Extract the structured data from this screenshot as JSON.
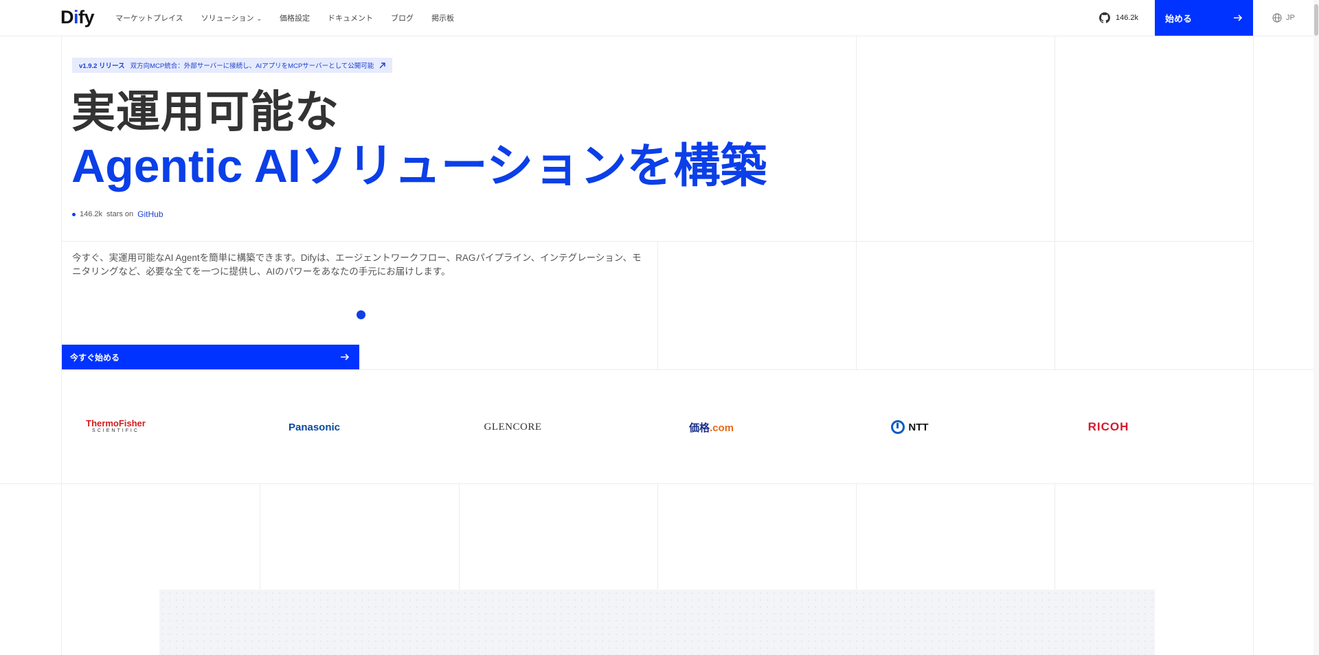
{
  "header": {
    "logo_text_d": "D",
    "logo_text_i": "i",
    "logo_text_fy": "fy",
    "nav": [
      "マーケットプレイス",
      "ソリューション",
      "価格設定",
      "ドキュメント",
      "ブログ",
      "掲示板"
    ],
    "github_stars": "146.2k",
    "start_label": "始める",
    "lang": "JP"
  },
  "hero": {
    "release_version": "v1.9.2 リリース",
    "release_text": "双方向MCP統合：外部サーバーに接続し、AIアプリをMCPサーバーとして公開可能",
    "title_line1": "実運用可能な",
    "title_line2": "Agentic AIソリューションを構築",
    "stars_count": "146.2k",
    "stars_mid": "stars on",
    "stars_link": "GitHub",
    "description": "今すぐ、実運用可能なAI Agentを簡単に構築できます。Difyは、エージェントワークフロー、RAGパイプライン、インテグレーション、モニタリングなど、必要な全てを一つに提供し、AIのパワーをあなたの手元にお届けします。",
    "cta_label": "今すぐ始める"
  },
  "logos": {
    "thermo_top": "ThermoFisher",
    "thermo_bottom": "SCIENTIFIC",
    "panasonic": "Panasonic",
    "glencore": "GLENCORE",
    "kakaku_main": "価格",
    "kakaku_com": ".com",
    "ntt": "NTT",
    "ricoh": "RICOH"
  },
  "colors": {
    "accent": "#0033ff",
    "title_blue": "#0b3fe8",
    "release_bg": "#e6ebfd"
  }
}
